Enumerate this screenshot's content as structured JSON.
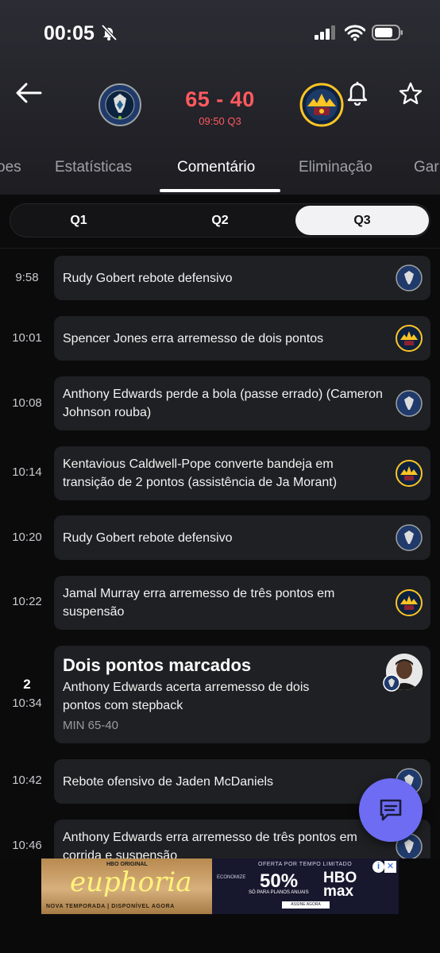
{
  "status_bar": {
    "time": "00:05"
  },
  "game": {
    "score": "65 - 40",
    "clock": "09:50 Q3"
  },
  "tabs": [
    "oes",
    "Estatísticas",
    "Comentário",
    "Eliminação",
    "Gar"
  ],
  "quarters": [
    "Q1",
    "Q2",
    "Q3"
  ],
  "events": [
    {
      "time": "9:58",
      "text": "Rudy Gobert rebote defensivo",
      "team": "timberwolves"
    },
    {
      "time": "10:01",
      "text": "Spencer Jones erra arremesso de dois pontos",
      "team": "nuggets"
    },
    {
      "time": "10:08",
      "text": "Anthony Edwards perde a bola (passe errado) (Cameron Johnson rouba)",
      "team": "timberwolves"
    },
    {
      "time": "10:14",
      "text": "Kentavious Caldwell-Pope converte bandeja em transição de 2 pontos (assistência de Ja Morant)",
      "team": "nuggets"
    },
    {
      "time": "10:20",
      "text": "Rudy Gobert rebote defensivo",
      "team": "timberwolves"
    },
    {
      "time": "10:22",
      "text": "Jamal Murray erra arremesso de três pontos em suspensão",
      "team": "nuggets"
    }
  ],
  "score_event": {
    "points": "2",
    "time": "10:34",
    "title": "Dois pontos marcados",
    "text": "Anthony Edwards acerta arremesso de dois pontos com stepback",
    "sub": "MIN 65-40"
  },
  "events_after": [
    {
      "time": "10:42",
      "text": "Rebote ofensivo de Jaden McDaniels",
      "team": "timberwolves"
    },
    {
      "time": "10:46",
      "text": "Anthony Edwards erra arremesso de três pontos em corrida e suspensão",
      "team": "timberwolves"
    }
  ],
  "ad": {
    "hbo_small": "HBO ORIGINAL",
    "title": "euphoria",
    "subtitle": "NOVA TEMPORADA | DISPONÍVEL AGORA",
    "offer": "OFERTA POR TEMPO LIMITADO",
    "from": "ECONOMIZE",
    "percent": "50%",
    "brand_top": "HBO",
    "brand_bottom": "max",
    "annual": "SÓ PARA PLANOS ANUAIS",
    "cta": "ASSINE AGORA",
    "info": "i",
    "close": "✕"
  },
  "colors": {
    "score_red": "#ff5a5f",
    "fab": "#6d6cf2",
    "card_bg": "#1f2023"
  }
}
